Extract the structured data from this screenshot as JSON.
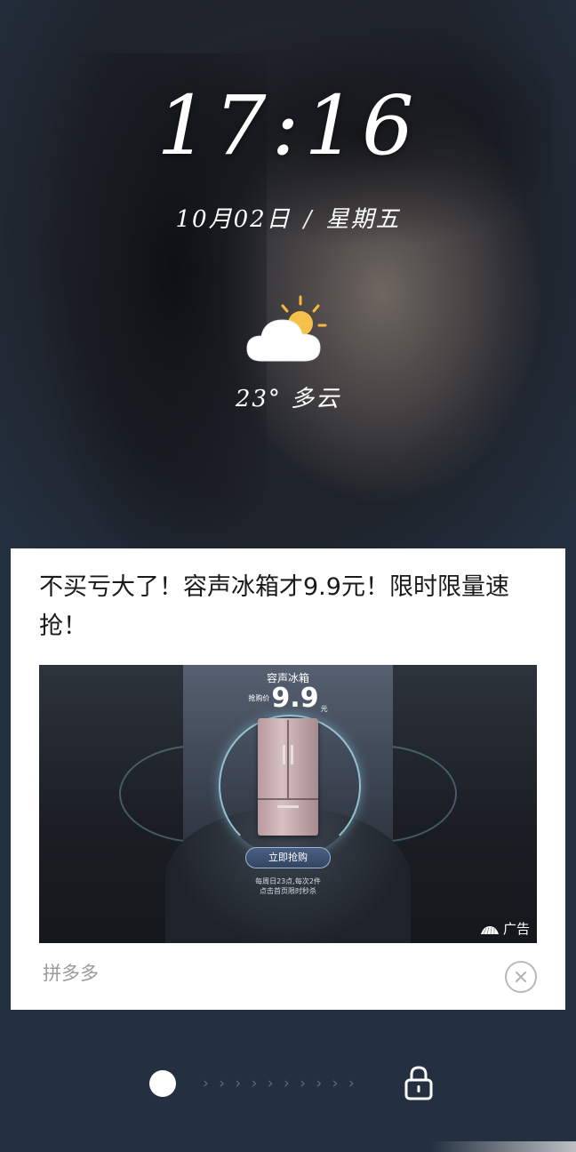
{
  "lockscreen": {
    "time": "17:16",
    "date": "10月02日",
    "date_separator": "/",
    "weekday": "星期五",
    "weather": {
      "icon": "partly-cloudy-icon",
      "temperature": "23°",
      "condition": "多云"
    }
  },
  "ad": {
    "title": "不买亏大了！容声冰箱才9.9元！限时限量速抢！",
    "image": {
      "product_name": "容声冰箱",
      "price_label": "抢购价",
      "price_value": "9.9",
      "price_unit": "元",
      "buy_button": "立即抢购",
      "note_line1": "每周日23点,每次2件",
      "note_line2": "点击首页限时秒杀",
      "ad_badge": "广告"
    },
    "source": "拼多多",
    "close_icon": "close-circle-icon"
  },
  "unlock": {
    "slider_icon": "slider-dot-icon",
    "arrows": "› › › › › › › › › ›",
    "lock_icon": "lock-icon"
  },
  "colors": {
    "card_bg": "#ffffff",
    "source_text": "#9a9a9a",
    "button_border": "#9fb6d8"
  }
}
